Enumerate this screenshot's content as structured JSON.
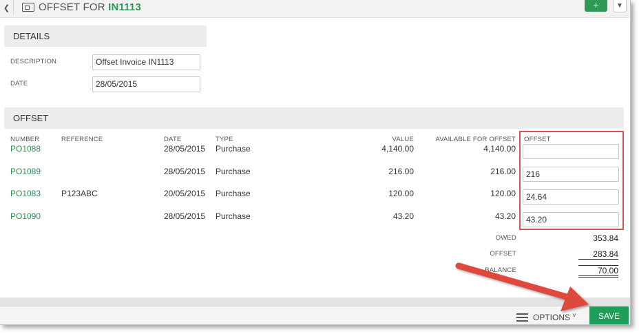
{
  "window": {
    "title_prefix": "OFFSET FOR ",
    "title_ref": "IN1113",
    "back_icon": "chevron-left-icon",
    "add_label": "+",
    "menu_chevron": "chevron-down-icon"
  },
  "details": {
    "header": "DETAILS",
    "description_label": "DESCRIPTION",
    "description_value": "Offset Invoice IN1113",
    "date_label": "DATE",
    "date_value": "28/05/2015"
  },
  "offset": {
    "header": "OFFSET",
    "columns": {
      "number": "NUMBER",
      "reference": "REFERENCE",
      "date": "DATE",
      "type": "TYPE",
      "value": "VALUE",
      "available": "AVAILABLE FOR OFFSET",
      "offset": "OFFSET"
    },
    "rows": [
      {
        "number": "PO1088",
        "reference": "",
        "date": "28/05/2015",
        "type": "Purchase",
        "value": "4,140.00",
        "available": "4,140.00",
        "offset": ""
      },
      {
        "number": "PO1089",
        "reference": "",
        "date": "28/05/2015",
        "type": "Purchase",
        "value": "216.00",
        "available": "216.00",
        "offset": "216"
      },
      {
        "number": "PO1083",
        "reference": "P123ABC",
        "date": "20/05/2015",
        "type": "Purchase",
        "value": "120.00",
        "available": "120.00",
        "offset": "24.64"
      },
      {
        "number": "PO1090",
        "reference": "",
        "date": "28/05/2015",
        "type": "Purchase",
        "value": "43.20",
        "available": "43.20",
        "offset": "43.20"
      }
    ],
    "summary": {
      "owed_label": "OWED",
      "owed_value": "353.84",
      "offset_label": "OFFSET",
      "offset_value": "283.84",
      "balance_label": "BALANCE",
      "balance_value": "70.00"
    }
  },
  "footer": {
    "options_label": "OPTIONS",
    "save_label": "SAVE"
  },
  "colors": {
    "accent_green": "#2e9a57",
    "highlight_red": "#d9534f"
  }
}
